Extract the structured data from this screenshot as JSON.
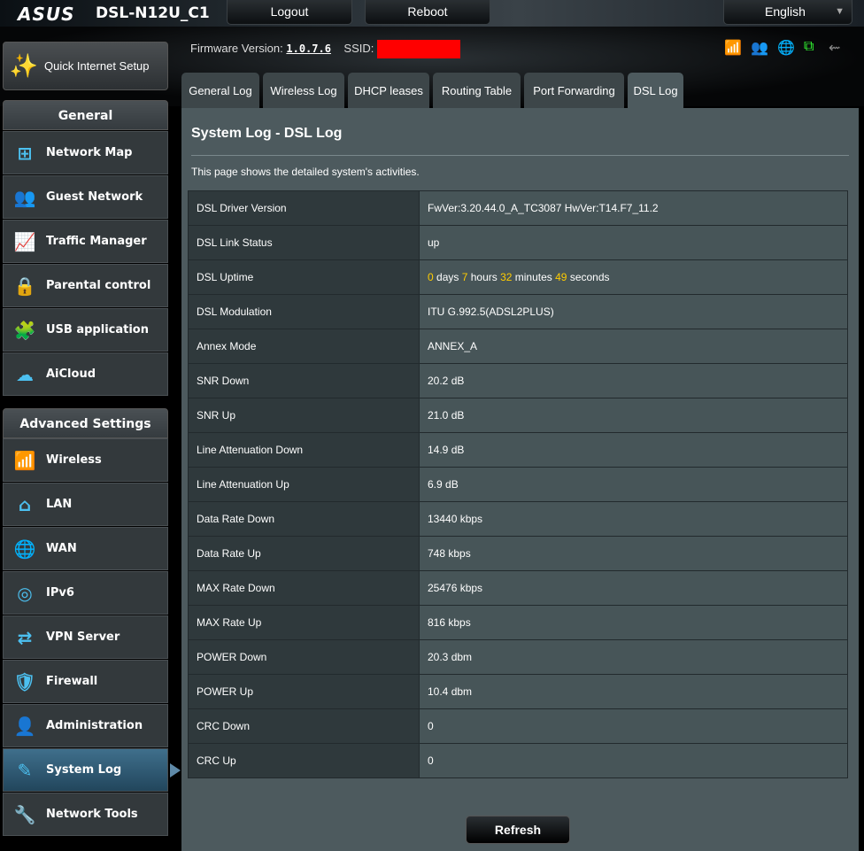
{
  "header": {
    "brand": "ASUS",
    "model": "DSL-N12U_C1",
    "logout": "Logout",
    "reboot": "Reboot",
    "language": "English"
  },
  "status": {
    "firmware_label": "Firmware Version:",
    "firmware": "1.0.7.6",
    "ssid_label": "SSID:"
  },
  "sidebar": {
    "quick_setup": "Quick Internet Setup",
    "general": "General",
    "general_items": [
      "Network Map",
      "Guest Network",
      "Traffic Manager",
      "Parental control",
      "USB application",
      "AiCloud"
    ],
    "advanced": "Advanced Settings",
    "advanced_items": [
      "Wireless",
      "LAN",
      "WAN",
      "IPv6",
      "VPN Server",
      "Firewall",
      "Administration",
      "System Log",
      "Network Tools"
    ]
  },
  "tabs": [
    "General Log",
    "Wireless Log",
    "DHCP leases",
    "Routing Table",
    "Port Forwarding",
    "DSL Log"
  ],
  "main": {
    "title": "System Log - DSL Log",
    "description": "This page shows the detailed system's activities.",
    "refresh": "Refresh",
    "uptime": {
      "days": "0",
      "days_label": " days ",
      "hours": "7",
      "hours_label": " hours ",
      "minutes": "32",
      "minutes_label": " minutes ",
      "seconds": "49",
      "seconds_label": " seconds"
    },
    "rows": [
      {
        "label": "DSL Driver Version",
        "value": "FwVer:3.20.44.0_A_TC3087 HwVer:T14.F7_11.2"
      },
      {
        "label": "DSL Link Status",
        "value": "up"
      },
      {
        "label": "DSL Uptime",
        "value": ""
      },
      {
        "label": "DSL Modulation",
        "value": "ITU G.992.5(ADSL2PLUS)"
      },
      {
        "label": "Annex Mode",
        "value": "ANNEX_A"
      },
      {
        "label": "SNR Down",
        "value": "20.2 dB"
      },
      {
        "label": "SNR Up",
        "value": "21.0 dB"
      },
      {
        "label": "Line Attenuation Down",
        "value": "14.9 dB"
      },
      {
        "label": "Line Attenuation Up",
        "value": "6.9 dB"
      },
      {
        "label": "Data Rate Down",
        "value": "13440 kbps"
      },
      {
        "label": "Data Rate Up",
        "value": "748 kbps"
      },
      {
        "label": "MAX Rate Down",
        "value": "25476 kbps"
      },
      {
        "label": "MAX Rate Up",
        "value": "816 kbps"
      },
      {
        "label": "POWER Down",
        "value": "20.3 dbm"
      },
      {
        "label": "POWER Up",
        "value": "10.4 dbm"
      },
      {
        "label": "CRC Down",
        "value": "0"
      },
      {
        "label": "CRC Up",
        "value": "0"
      }
    ]
  }
}
